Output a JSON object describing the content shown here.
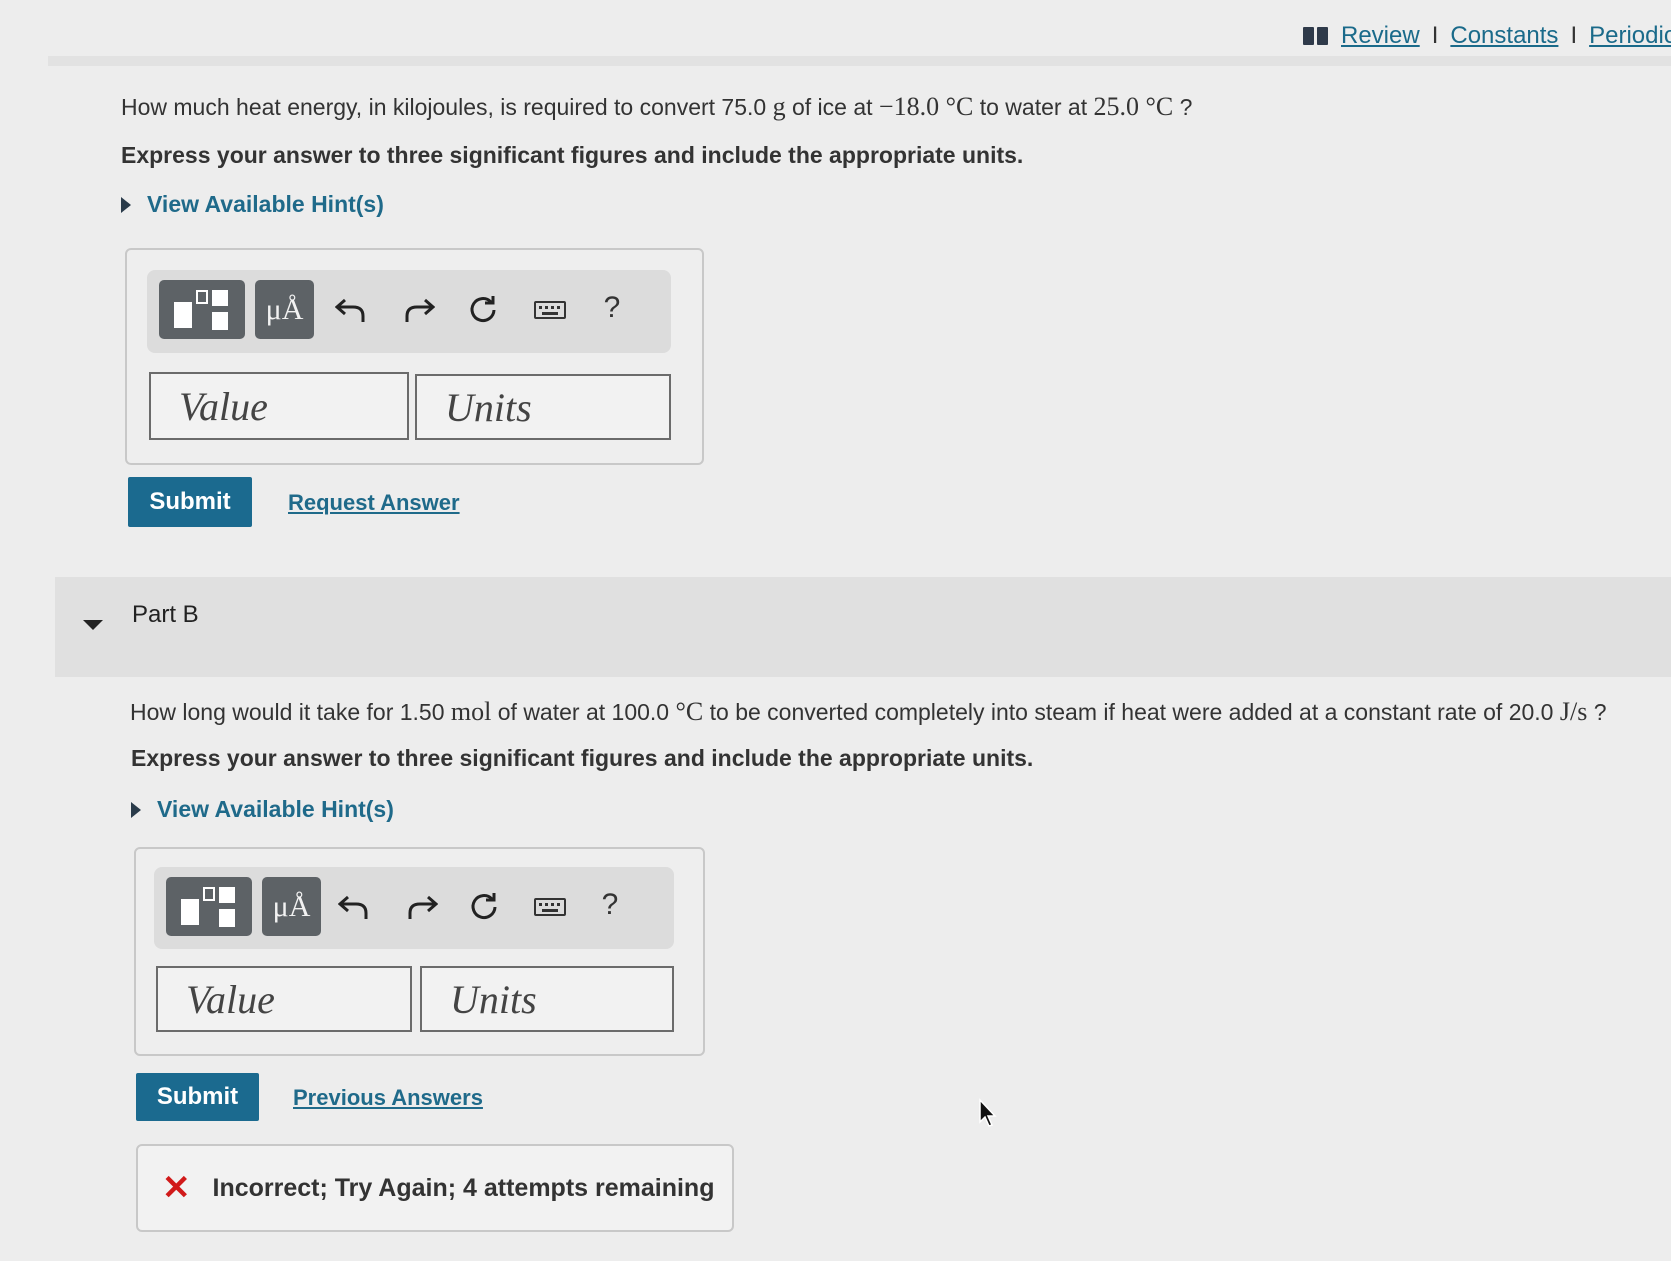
{
  "header": {
    "links": [
      "Review",
      "Constants",
      "Periodic"
    ]
  },
  "partA": {
    "question": {
      "pre": "How much heat energy, in kilojoules, is required to convert 75.0 ",
      "unit1": "g",
      "mid1": " of ice at ",
      "temp1": "−18.0 °C",
      "mid2": " to water at ",
      "temp2": "25.0 °C",
      "post": " ?"
    },
    "instruction": "Express your answer to three significant figures and include the appropriate units.",
    "hint_label": "View Available Hint(s)",
    "toolbar": {
      "units_button": "μÅ",
      "help": "?"
    },
    "value_placeholder": "Value",
    "units_placeholder": "Units",
    "submit_label": "Submit",
    "secondary_link": "Request Answer"
  },
  "partB": {
    "title": "Part B",
    "question": {
      "pre": "How long would it take for 1.50 ",
      "unit1": "mol",
      "mid1": " of water at 100.0 ",
      "temp1": "°C",
      "mid2": " to be converted completely into steam if heat were added at a constant rate of 20.0 ",
      "rate": "J/s",
      "post": " ?"
    },
    "instruction": "Express your answer to three significant figures and include the appropriate units.",
    "hint_label": "View Available Hint(s)",
    "toolbar": {
      "units_button": "μÅ",
      "help": "?"
    },
    "value_placeholder": "Value",
    "units_placeholder": "Units",
    "submit_label": "Submit",
    "secondary_link": "Previous Answers",
    "feedback": "Incorrect; Try Again; 4 attempts remaining"
  },
  "colors": {
    "accent": "#1b6a8f",
    "link": "#1f6a8a",
    "error": "#d11a1a"
  }
}
